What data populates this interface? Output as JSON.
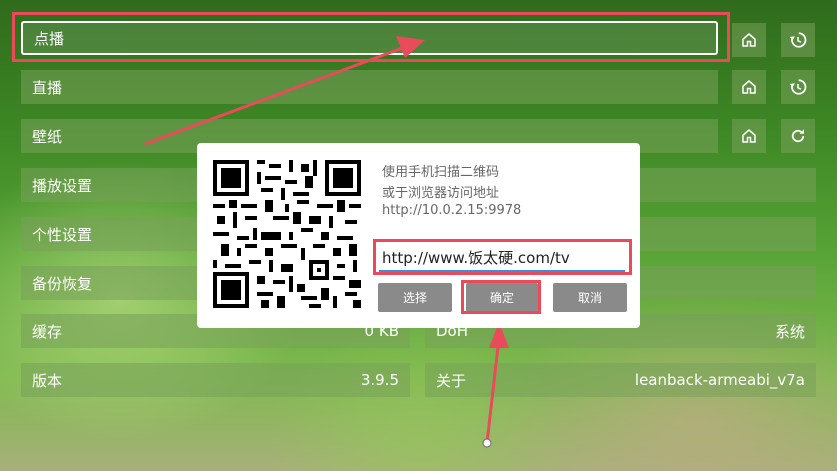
{
  "menu": {
    "vod": "点播",
    "live": "直播",
    "wallpaper": "壁纸",
    "playback_settings": "播放设置",
    "personalization": "个性设置",
    "backup_restore": "备份恢复"
  },
  "info": {
    "cache_label": "缓存",
    "cache_value": "0 KB",
    "doh_label": "DoH",
    "doh_value": "系统",
    "version_label": "版本",
    "version_value": "3.9.5",
    "about_label": "关于",
    "about_value": "leanback-armeabi_v7a"
  },
  "icons": {
    "home": "home-icon",
    "history": "history-icon",
    "refresh": "refresh-icon"
  },
  "dialog": {
    "line1": "使用手机扫描二维码",
    "line2": "或于浏览器访问地址",
    "address": "http://10.0.2.15:9978",
    "url_value": "http://www.饭太硬.com/tv",
    "select_label": "选择",
    "confirm_label": "确定",
    "cancel_label": "取消"
  },
  "colors": {
    "highlight": "#e94b5a",
    "field_underline": "#3a8fd8"
  }
}
